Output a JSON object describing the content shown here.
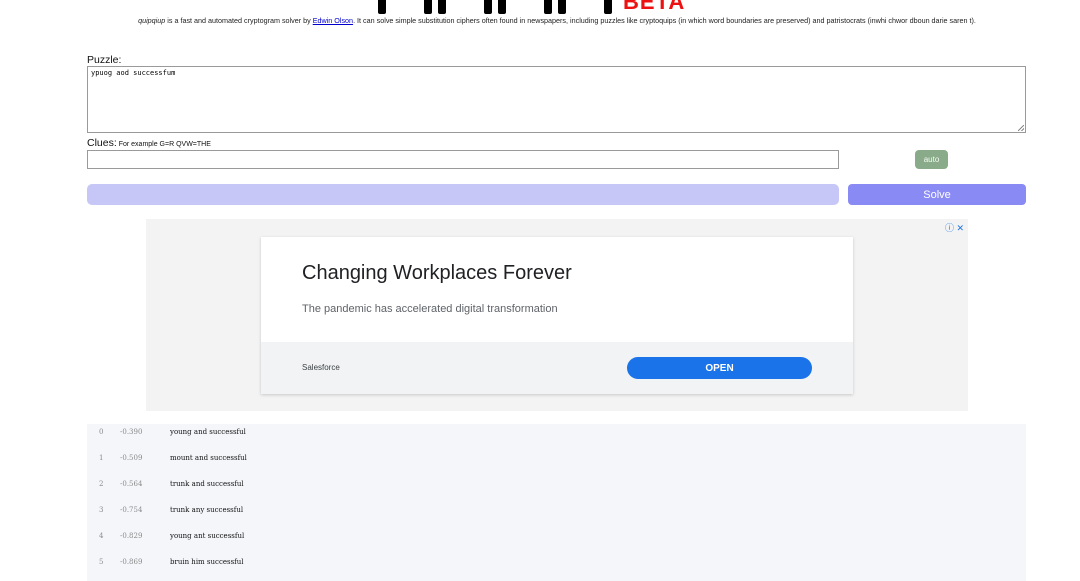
{
  "header": {
    "beta_label": "BETA"
  },
  "intro": {
    "app_name": "quipqiup",
    "text_before_link": " is a fast and automated cryptogram solver by ",
    "author_link": "Edwin Olson",
    "text_after_link": ". It can solve simple substitution ciphers often found in newspapers, including puzzles like cryptoquips (in which word boundaries are preserved) and patristocrats (inwhi chwor dboun darie saren t)."
  },
  "puzzle": {
    "label": "Puzzle:",
    "value": "ypuog aod successfum"
  },
  "clues": {
    "label": "Clues:",
    "example": " For example G=R QVW=THE",
    "value": ""
  },
  "buttons": {
    "auto_label": "auto",
    "solve_label": "Solve"
  },
  "ad": {
    "headline": "Changing Workplaces Forever",
    "description": "The pandemic has accelerated digital transformation",
    "brand": "Salesforce",
    "cta": "OPEN",
    "controls": "ⓘ ✕",
    "accent_color": "#1a73e8"
  },
  "results": [
    {
      "index": "0",
      "score": "-0.390",
      "solution": "young and successful"
    },
    {
      "index": "1",
      "score": "-0.509",
      "solution": "mount and successful"
    },
    {
      "index": "2",
      "score": "-0.564",
      "solution": "trunk and successful"
    },
    {
      "index": "3",
      "score": "-0.754",
      "solution": "trunk any successful"
    },
    {
      "index": "4",
      "score": "-0.829",
      "solution": "young ant successful"
    },
    {
      "index": "5",
      "score": "-0.869",
      "solution": "bruin him successful"
    }
  ],
  "colors": {
    "beta": "#ee1111",
    "progress_bar": "#c7c7f7",
    "solve_button": "#8a8af5",
    "auto_button": "#8aab8a",
    "results_bg": "#f4f6fa"
  }
}
